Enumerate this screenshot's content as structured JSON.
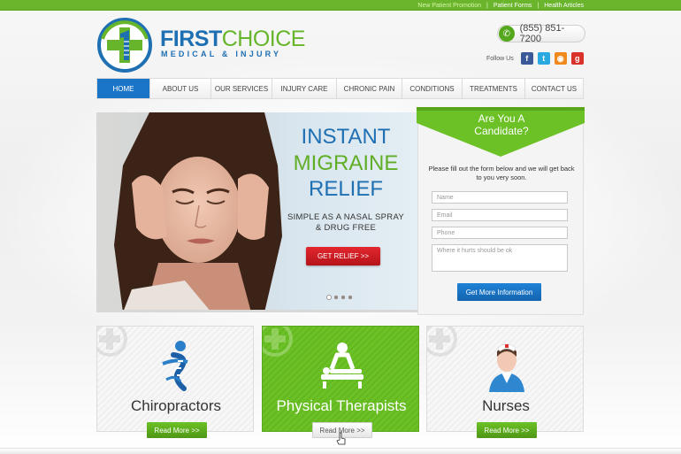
{
  "topbar": {
    "links": [
      "New Patient Promotion",
      "Patient Forms",
      "Health Articles"
    ],
    "separator": "|"
  },
  "brand": {
    "name_first": "FIRST",
    "name_second": "CHOICE",
    "tagline": "MEDICAL & INJURY"
  },
  "contact": {
    "phone": "(855) 851-7200",
    "follow_label": "Follow Us"
  },
  "social": [
    {
      "icon": "facebook-icon",
      "glyph": "f",
      "color": "#3b5998"
    },
    {
      "icon": "twitter-icon",
      "glyph": "t",
      "color": "#2aa9e0"
    },
    {
      "icon": "rss-icon",
      "glyph": "◉",
      "color": "#f08a1c"
    },
    {
      "icon": "google-plus-icon",
      "glyph": "g",
      "color": "#d9322a"
    }
  ],
  "nav": [
    {
      "label": "HOME",
      "active": true
    },
    {
      "label": "ABOUT US"
    },
    {
      "label": "OUR SERVICES"
    },
    {
      "label": "INJURY CARE"
    },
    {
      "label": "CHRONIC PAIN"
    },
    {
      "label": "CONDITIONS"
    },
    {
      "label": "TREATMENTS"
    },
    {
      "label": "CONTACT US"
    }
  ],
  "hero": {
    "line1": "INSTANT",
    "line2": "MIGRAINE",
    "line3": "RELIEF",
    "subline1": "SIMPLE AS A NASAL SPRAY",
    "subline2": "& DRUG FREE",
    "cta": "GET RELIEF >>",
    "colors": {
      "blue": "#1f6fb3",
      "green": "#5fae25",
      "cta": "#d11f26"
    }
  },
  "form": {
    "heading_line1": "Are You A",
    "heading_line2": "Candidate?",
    "description": "Please fill out the form below and we will get back to you very soon.",
    "fields": [
      {
        "placeholder": "Name"
      },
      {
        "placeholder": "Email"
      },
      {
        "placeholder": "Phone"
      },
      {
        "placeholder": "Where it hurts should be ok"
      }
    ],
    "submit": "Get More Information"
  },
  "services": [
    {
      "title": "Chiropractors",
      "button": "Read More >>",
      "icon": "spine-icon"
    },
    {
      "title": "Physical Therapists",
      "button": "Read More >>",
      "icon": "massage-icon"
    },
    {
      "title": "Nurses",
      "button": "Read More >>",
      "icon": "nurse-icon"
    }
  ]
}
